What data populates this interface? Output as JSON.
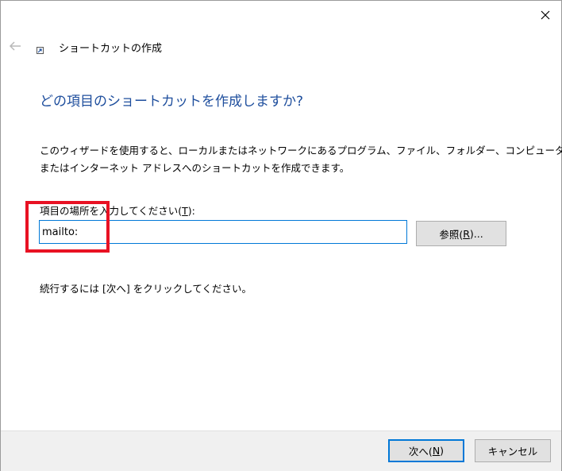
{
  "wizard": {
    "title": "ショートカットの作成",
    "heading": "どの項目のショートカットを作成しますか?",
    "description_line1": "このウィザードを使用すると、ローカルまたはネットワークにあるプログラム、ファイル、フォルダー、コンピューター、",
    "description_line2": "またはインターネット アドレスへのショートカットを作成できます。"
  },
  "location": {
    "label_before": "項目の場所を入力してください(",
    "label_accel": "T",
    "label_after": "):",
    "value": "mailto:"
  },
  "browse": {
    "label_before": "参照(",
    "label_accel": "R",
    "label_after": ")..."
  },
  "continue_text": "続行するには [次へ] をクリックしてください。",
  "footer": {
    "next_before": "次へ(",
    "next_accel": "N",
    "next_after": ")",
    "cancel_label": "キャンセル"
  },
  "icons": {
    "close": "close-icon",
    "back": "back-arrow-icon",
    "wizard": "shortcut-icon"
  },
  "colors": {
    "heading": "#1e4e9d",
    "accent": "#0078d7",
    "highlight": "#e81123"
  }
}
